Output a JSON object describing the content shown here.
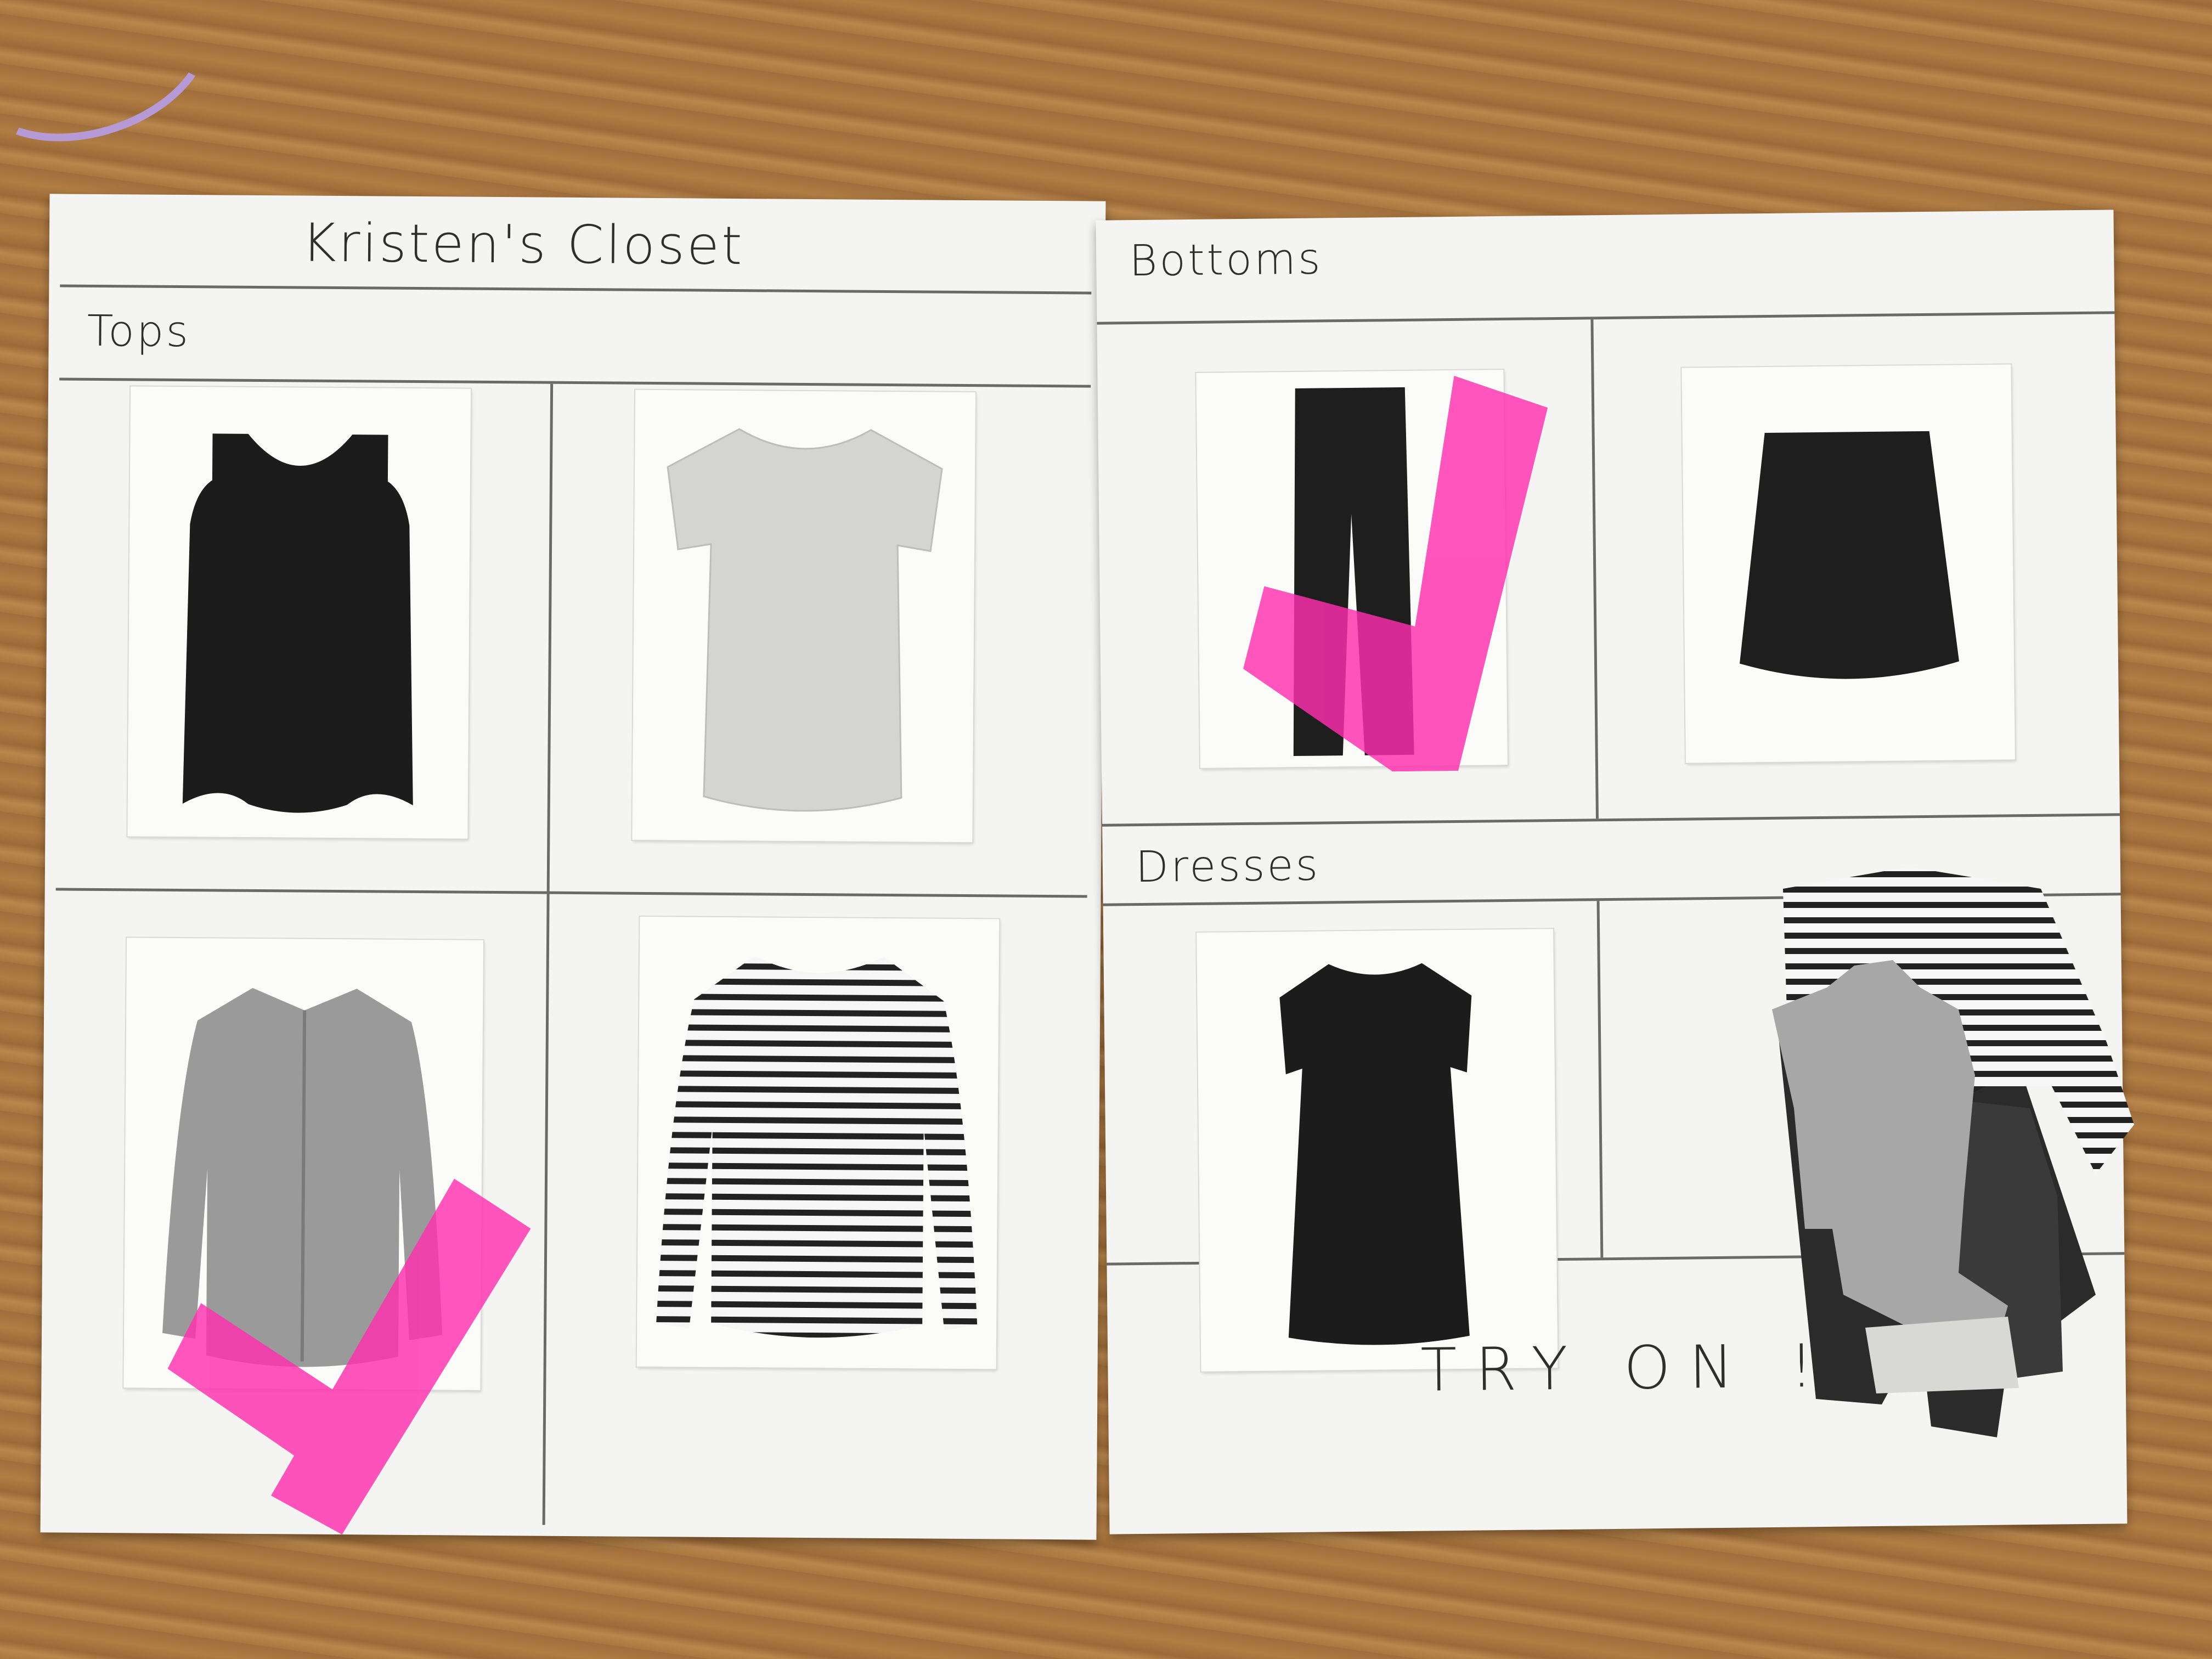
{
  "closet": {
    "title": "Kristen's Closet",
    "actions": {
      "try_on_label": "TRY ON !"
    }
  },
  "sections": {
    "tops": {
      "label": "Tops",
      "items": [
        {
          "name": "black tank top",
          "selected": false
        },
        {
          "name": "light grey t-shirt",
          "selected": false
        },
        {
          "name": "chambray button-up shirt",
          "selected": true
        },
        {
          "name": "striped long-sleeve top",
          "selected": false
        }
      ]
    },
    "bottoms": {
      "label": "Bottoms",
      "items": [
        {
          "name": "black skinny jeans",
          "selected": true
        },
        {
          "name": "black skater skirt",
          "selected": false
        }
      ]
    },
    "dresses": {
      "label": "Dresses",
      "items": [
        {
          "name": "black t-shirt dress",
          "selected": false
        }
      ]
    }
  },
  "selection_marker": {
    "icon": "checkmark-icon",
    "color": "#ff2fae"
  },
  "try_on_pile": [
    "striped long-sleeve top",
    "chambray button-up shirt",
    "black skinny jeans",
    "black skater skirt"
  ],
  "colors": {
    "paper": "#f4f4f2",
    "ink": "#2e2e2e",
    "table": "#a8763f"
  }
}
